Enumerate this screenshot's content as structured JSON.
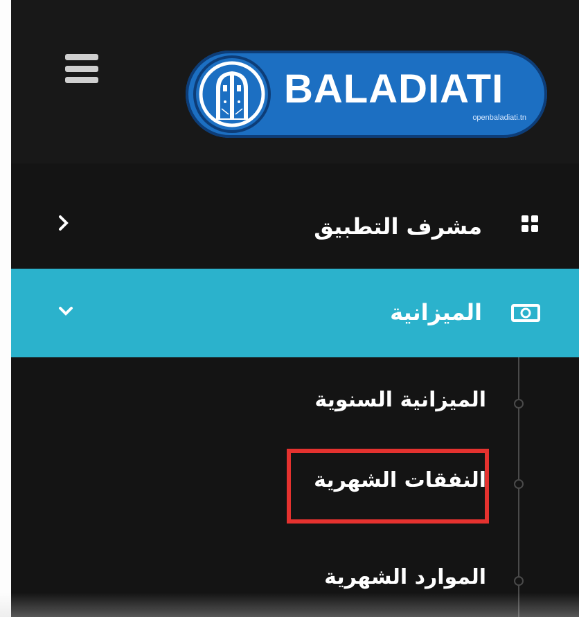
{
  "header": {
    "menu_icon": "hamburger-icon",
    "logo": {
      "wordmark": "BALADIATI",
      "url_text": "openbaladiati.tn",
      "emblem_icon": "door-arch-emblem-icon",
      "color": "#1c6fc2"
    }
  },
  "sidebar": {
    "background": "#141414",
    "items": [
      {
        "label": "مشرف التطبيق",
        "icon": "grid-icon",
        "chevron": "chevron-right-icon",
        "active": false
      },
      {
        "label": "الميزانية",
        "icon": "money-bill-icon",
        "chevron": "chevron-down-icon",
        "active": true,
        "active_color": "#2bb2cc"
      }
    ],
    "submenu": [
      {
        "label": "الميزانية السنوية"
      },
      {
        "label": "النفقات الشهرية",
        "highlighted": true,
        "highlight_color": "#e5322f"
      },
      {
        "label": "الموارد الشهرية"
      }
    ]
  }
}
